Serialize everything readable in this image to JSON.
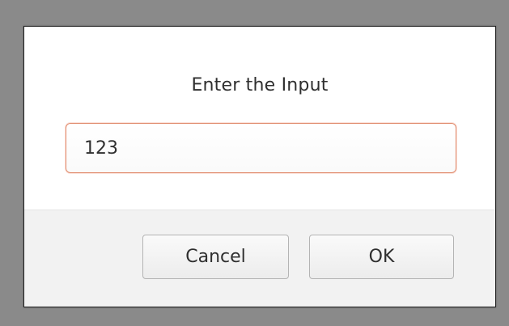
{
  "dialog": {
    "title": "Enter the Input",
    "input_value": "123",
    "cancel_label": "Cancel",
    "ok_label": "OK"
  },
  "colors": {
    "backdrop": "#8a8a8a",
    "dialog_bg": "#ffffff",
    "footer_bg": "#f2f2f2",
    "input_focus_border": "#e08a6b",
    "text": "#2f2f2f"
  }
}
